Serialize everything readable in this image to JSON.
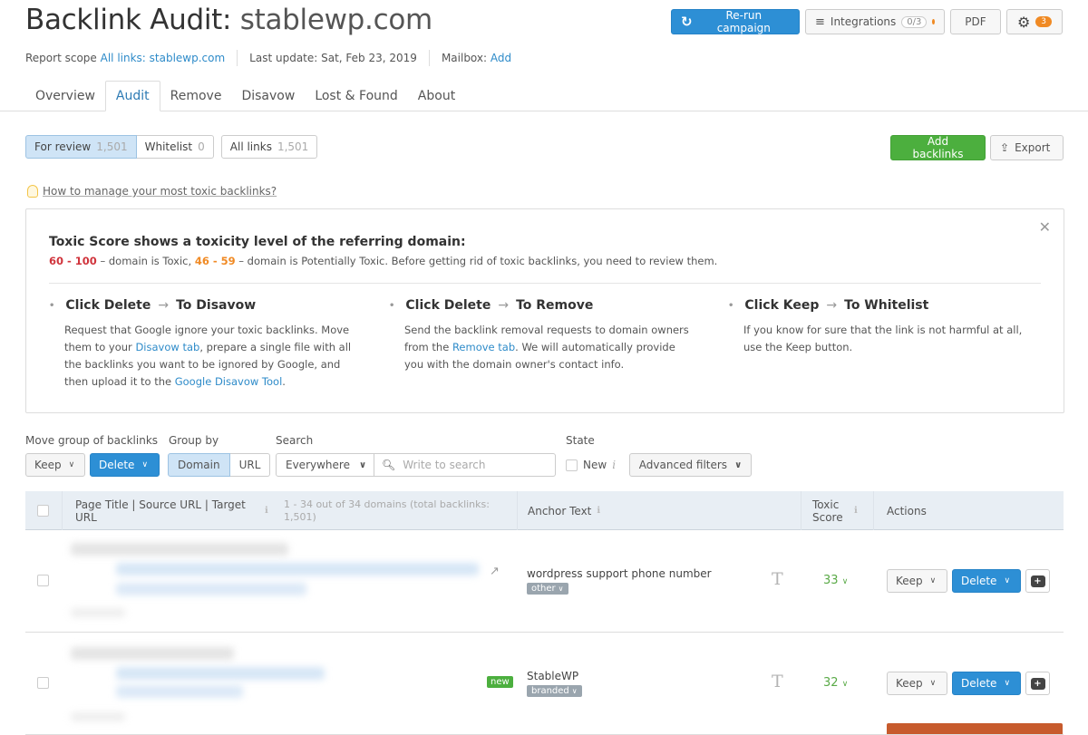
{
  "header": {
    "title_prefix": "Backlink Audit: ",
    "title_domain": "stablewp.com",
    "report_scope_label": "Report scope ",
    "report_scope_value": "All links: stablewp.com",
    "last_update": "Last update: Sat, Feb 23, 2019",
    "mailbox_label": "Mailbox: ",
    "mailbox_link": "Add"
  },
  "toolbar": {
    "rerun_label": "Re-run campaign",
    "integrations_label": "Integrations",
    "integrations_count": "0/3",
    "pdf_label": "PDF",
    "settings_badge": "3"
  },
  "tabs": [
    {
      "label": "Overview",
      "active": false
    },
    {
      "label": "Audit",
      "active": true
    },
    {
      "label": "Remove",
      "active": false
    },
    {
      "label": "Disavow",
      "active": false
    },
    {
      "label": "Lost & Found",
      "active": false
    },
    {
      "label": "About",
      "active": false
    }
  ],
  "filters_top": {
    "for_review_label": "For review",
    "for_review_count": "1,501",
    "whitelist_label": "Whitelist",
    "whitelist_count": "0",
    "all_links_label": "All links",
    "all_links_count": "1,501",
    "add_backlinks_label": "Add backlinks",
    "export_label": "Export"
  },
  "howto_link": "How to manage your most toxic backlinks?",
  "info": {
    "heading": "Toxic Score shows a toxicity level of the referring domain:",
    "range_toxic": "60 - 100",
    "text_toxic": " – domain is Toxic, ",
    "range_potential": "46 - 59",
    "text_potential": " – domain is Potentially Toxic. Before getting rid of toxic backlinks, you need to review them.",
    "columns": [
      {
        "action": "Click Delete",
        "result": "To Disavow",
        "text_1": "Request that Google ignore your toxic backlinks. Move them to your ",
        "link_1": "Disavow tab",
        "text_2": ", prepare a single file with all the backlinks you want to be ignored by Google, and then upload it to the ",
        "link_2": "Google Disavow Tool",
        "text_3": "."
      },
      {
        "action": "Click Delete",
        "result": "To Remove",
        "text_1": "Send the backlink removal requests to domain owners from the ",
        "link_1": "Remove tab",
        "text_2": ". We will automatically provide you with the domain owner's contact info.",
        "link_2": "",
        "text_3": ""
      },
      {
        "action": "Click Keep",
        "result": "To Whitelist",
        "text_1": "If you know for sure that the link is not harmful at all, use the Keep button.",
        "link_1": "",
        "text_2": "",
        "link_2": "",
        "text_3": ""
      }
    ]
  },
  "controls": {
    "move_group_label": "Move group of backlinks",
    "keep_label": "Keep",
    "delete_label": "Delete",
    "group_by_label": "Group by",
    "group_domain": "Domain",
    "group_url": "URL",
    "search_label": "Search",
    "search_scope": "Everywhere",
    "search_placeholder": "Write to search",
    "search_value": "",
    "state_label": "State",
    "new_label": "New",
    "advanced_filters_label": "Advanced filters"
  },
  "table": {
    "col_page": "Page Title | Source URL | Target URL",
    "summary": "1 - 34 out of 34 domains (total backlinks: 1,501)",
    "col_anchor": "Anchor Text",
    "col_toxic": "Toxic Score",
    "col_actions": "Actions",
    "rows": [
      {
        "anchor": "wordpress support phone number",
        "anchor_type": "other",
        "score": "33",
        "is_new": false,
        "keep": "Keep",
        "delete": "Delete"
      },
      {
        "anchor": "StableWP",
        "anchor_type": "branded",
        "score": "32",
        "is_new": true,
        "new_label": "new",
        "keep": "Keep",
        "delete": "Delete"
      }
    ]
  },
  "colors": {
    "primary_blue": "#2d8fd5",
    "green": "#4caf3e",
    "toxic_red": "#d0343c",
    "potential_orange": "#f08a24",
    "score_green": "#5aaa47"
  }
}
